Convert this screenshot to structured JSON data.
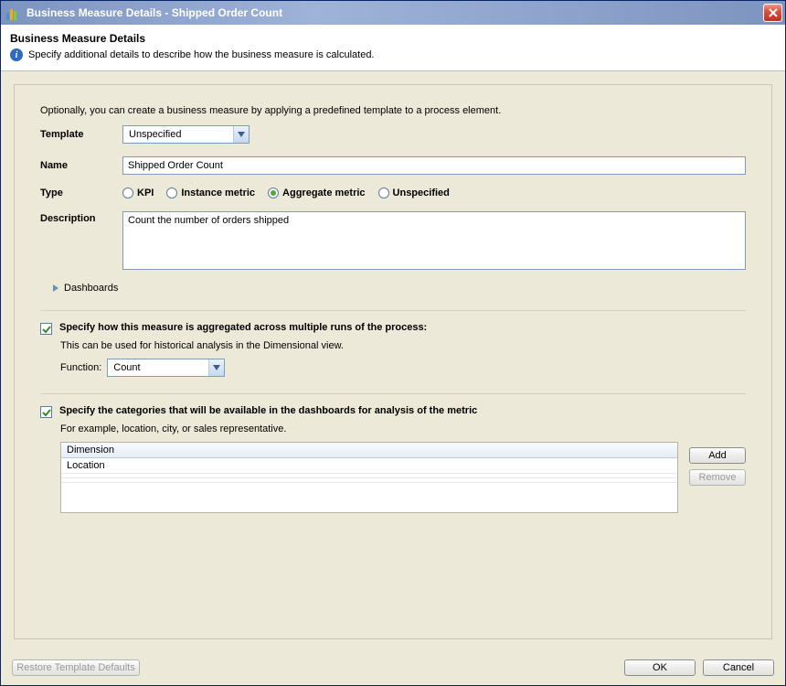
{
  "window": {
    "title": "Business Measure Details - Shipped Order Count"
  },
  "header": {
    "heading": "Business Measure Details",
    "subtext": "Specify additional details to describe how the business measure is calculated."
  },
  "intro": "Optionally, you can create a business measure by applying a predefined template to a process element.",
  "template": {
    "label": "Template",
    "value": "Unspecified"
  },
  "name": {
    "label": "Name",
    "value": "Shipped Order Count"
  },
  "type": {
    "label": "Type",
    "options": [
      "KPI",
      "Instance metric",
      "Aggregate metric",
      "Unspecified"
    ],
    "selected": "Aggregate metric"
  },
  "description": {
    "label": "Description",
    "value": "Count the number of orders shipped"
  },
  "expander": {
    "label": "Dashboards"
  },
  "aggregate": {
    "checked": true,
    "label": "Specify how this measure is aggregated across multiple runs of the process:",
    "hint": "This can be used for historical analysis in the Dimensional view.",
    "function_label": "Function:",
    "function_value": "Count"
  },
  "categories": {
    "checked": true,
    "label": "Specify the categories that will be available in the dashboards for analysis of the metric",
    "hint": "For example, location, city, or sales representative.",
    "table_header": "Dimension",
    "rows": [
      "Location"
    ],
    "add_label": "Add",
    "remove_label": "Remove"
  },
  "footer": {
    "restore": "Restore Template Defaults",
    "ok": "OK",
    "cancel": "Cancel"
  }
}
